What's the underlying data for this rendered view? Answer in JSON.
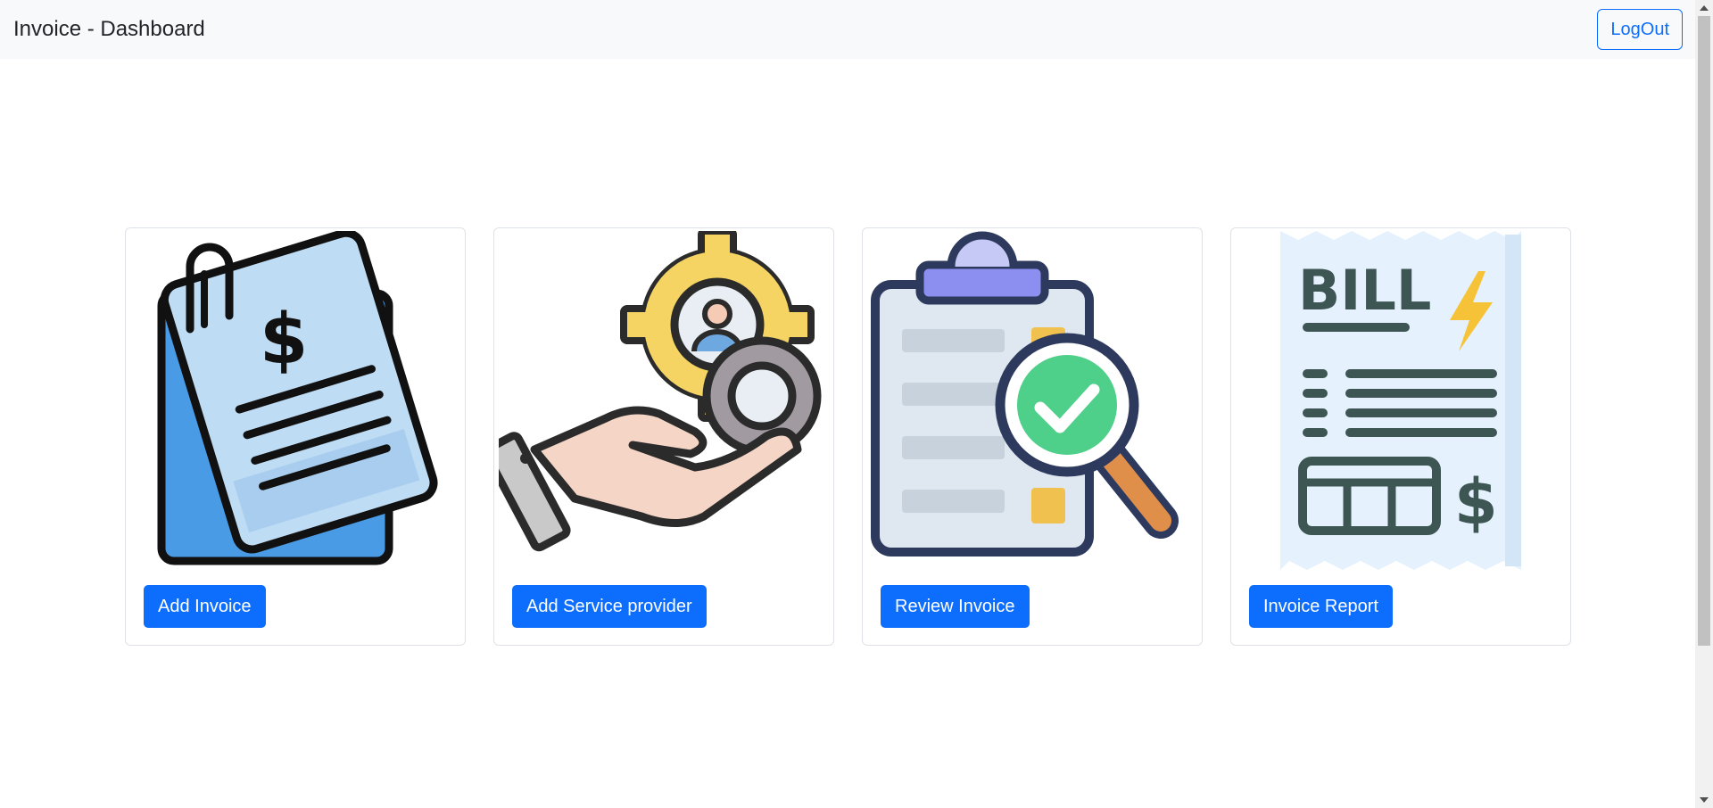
{
  "header": {
    "title": "Invoice - Dashboard",
    "logout_label": "LogOut"
  },
  "cards": [
    {
      "icon": "invoice-document-dollar-icon",
      "button_label": "Add Invoice"
    },
    {
      "icon": "hand-gears-service-provider-icon",
      "button_label": "Add Service provider"
    },
    {
      "icon": "clipboard-magnifier-check-icon",
      "button_label": "Review Invoice"
    },
    {
      "icon": "bill-receipt-icon",
      "button_label": "Invoice Report",
      "icon_text": "BILL"
    }
  ],
  "colors": {
    "primary": "#0d6efd",
    "navbar_bg": "#f8f9fa",
    "card_border": "#dee2e6"
  }
}
